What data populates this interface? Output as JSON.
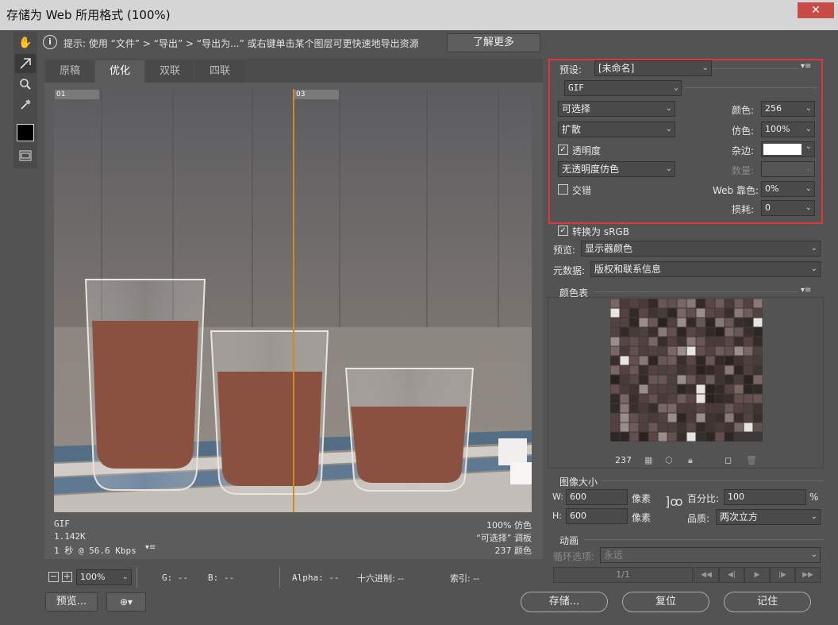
{
  "window": {
    "title": "存储为 Web 所用格式 (100%)",
    "close": "✕"
  },
  "hint": {
    "icon": "i",
    "text": "提示: 使用 “文件” > “导出” > “导出为...” 或右键单击某个图层可更快速地导出资源",
    "learn_more": "了解更多"
  },
  "tabs": [
    "原稿",
    "优化",
    "双联",
    "四联"
  ],
  "image_labels": {
    "left": "01",
    "right": "03"
  },
  "info": {
    "format": "GIF",
    "size": "1.142K",
    "time": "1 秒 @ 56.6 Kbps",
    "dither": "100% 仿色",
    "palette": "“可选择” 调板",
    "colors": "237 颜色"
  },
  "settings": {
    "preset_label": "预设:",
    "preset_value": "[未命名]",
    "format": "GIF",
    "reduction": "可选择",
    "colors_label": "颜色:",
    "colors_value": "256",
    "dither_algo": "扩散",
    "dither_label": "仿色:",
    "dither_value": "100%",
    "transparency_label": "透明度",
    "matte_label": "杂边:",
    "trans_dither": "无透明度仿色",
    "amount_label": "数量:",
    "interlaced_label": "交错",
    "web_snap_label": "Web 靠色:",
    "web_snap_value": "0%",
    "lossy_label": "损耗:",
    "lossy_value": "0"
  },
  "srgb": {
    "label": "转换为 sRGB"
  },
  "preview": {
    "label": "预览:",
    "value": "显示器颜色"
  },
  "metadata": {
    "label": "元数据:",
    "value": "版权和联系信息"
  },
  "color_table": {
    "title": "颜色表",
    "count": "237"
  },
  "image_size": {
    "title": "图像大小",
    "w_label": "W:",
    "w_value": "600",
    "h_label": "H:",
    "h_value": "600",
    "unit": "像素",
    "percent_label": "百分比:",
    "percent_value": "100",
    "percent_unit": "%",
    "quality_label": "品质:",
    "quality_value": "两次立方"
  },
  "animation": {
    "title": "动画",
    "loop_label": "循环选项:",
    "loop_value": "永远",
    "frame": "1/1"
  },
  "status": {
    "zoom": "100%",
    "g": "G: --",
    "b": "B: --",
    "alpha": "Alpha: --",
    "hex": "十六进制: --",
    "index": "索引: --"
  },
  "buttons": {
    "preview": "预览...",
    "save": "存储...",
    "reset": "复位",
    "remember": "记住"
  },
  "colors": {
    "highlight": "#e0353a",
    "split_line": "#c8901a"
  }
}
